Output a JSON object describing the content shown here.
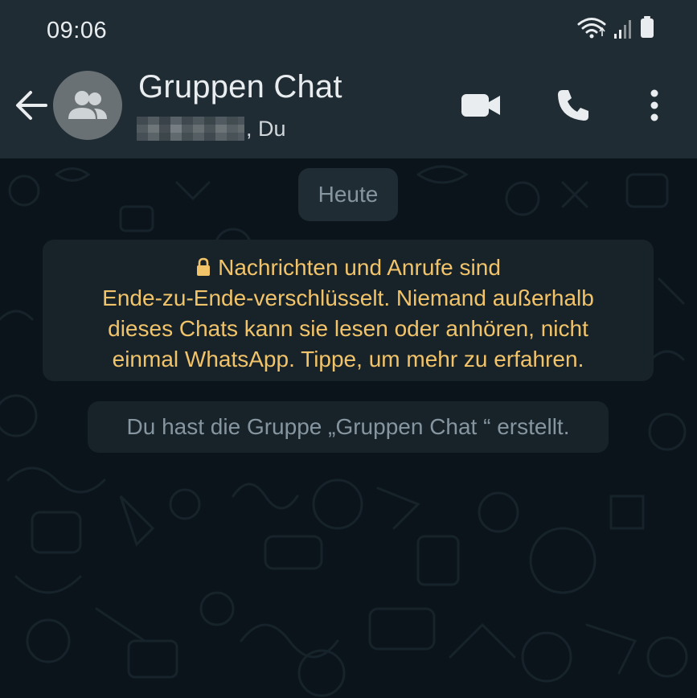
{
  "status_bar": {
    "time": "09:06",
    "icons": [
      "wifi-icon",
      "signal-icon",
      "battery-icon"
    ]
  },
  "header": {
    "back_icon": "arrow-left-icon",
    "avatar_icon": "group-icon",
    "title": "Gruppen Chat",
    "participants_suffix": ", Du",
    "actions": [
      "video-call-icon",
      "voice-call-icon",
      "more-vert-icon"
    ]
  },
  "chat": {
    "date_label": "Heute",
    "encryption_notice": {
      "line1": "Nachrichten und Anrufe sind",
      "line2": "Ende-zu-Ende-verschlüsselt. Niemand außerhalb",
      "line3": "dieses Chats kann sie lesen oder anhören, nicht",
      "line4": "einmal WhatsApp. Tippe, um mehr zu erfahren."
    },
    "system_message": "Du hast die Gruppe „Gruppen Chat “ erstellt."
  },
  "colors": {
    "header_bg": "#1f2c34",
    "chat_bg": "#0b141a",
    "notice_text": "#f2c46a",
    "muted_text": "#8696a0",
    "primary_text": "#e9edef"
  }
}
